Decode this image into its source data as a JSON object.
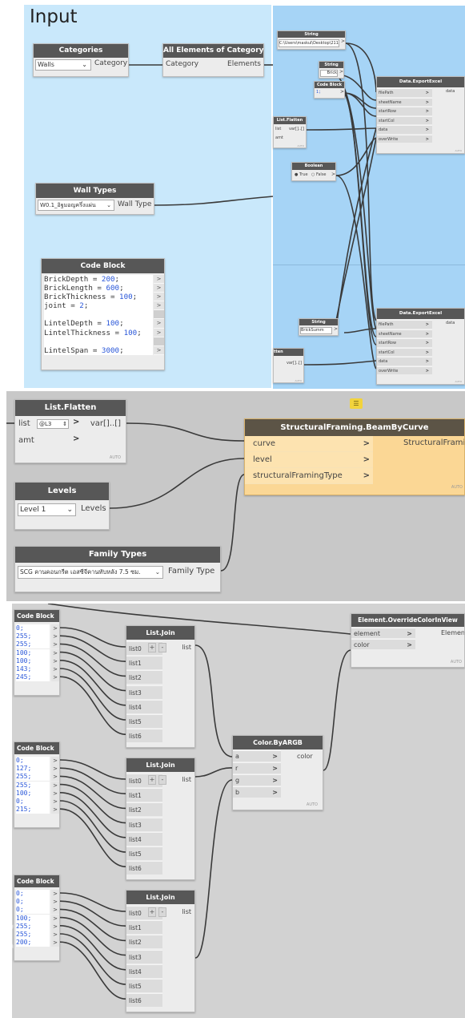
{
  "panel1": {
    "group_title": "Input",
    "categories": {
      "title": "Categories",
      "value": "Walls",
      "output": "Category"
    },
    "all_elements": {
      "title": "All Elements of Category",
      "input": "Category",
      "output": "Elements"
    },
    "wall_types": {
      "title": "Wall Types",
      "value": "W0.1_อิฐมอญครึ่งแผ่น",
      "output": "Wall Type"
    },
    "code_block": {
      "title": "Code Block",
      "lines": [
        "BrickDepth = 200;",
        "BrickLength = 600;",
        "BrickThickness = 100;",
        "joint = 2;",
        "",
        "LintelDepth = 100;",
        "LintelThickness = 100;",
        "",
        "LintelSpan = 3000;"
      ]
    },
    "string_path": {
      "title": "String",
      "value": "C:\\Users\\maskul\\Desktop\\2111"
    },
    "string_brick": {
      "title": "String",
      "value": "Brick"
    },
    "code_block_small": {
      "title": "Code Block",
      "value": "1;"
    },
    "list_flatten": {
      "title": "List.Flatten",
      "in1": "list",
      "in2": "amt",
      "out": "var[]..[]",
      "auto": "AUTO"
    },
    "boolean": {
      "title": "Boolean",
      "true_label": "True",
      "false_label": "False"
    },
    "export1": {
      "title": "Data.ExportExcel",
      "inputs": [
        "filePath",
        "sheetName",
        "startRow",
        "startCol",
        "data",
        "overWrite"
      ],
      "output": "data",
      "auto": "AUTO"
    },
    "string_summ": {
      "title": "String",
      "value": "BrickSumm"
    },
    "flatten_partial": {
      "title": "tten",
      "out": "var[]..[]",
      "auto": "AUTO"
    },
    "export2": {
      "title": "Data.ExportExcel",
      "inputs": [
        "filePath",
        "sheetName",
        "startRow",
        "startCol",
        "data",
        "overWrite"
      ],
      "output": "data",
      "auto": "AUTO"
    }
  },
  "panel2": {
    "list_flatten": {
      "title": "List.Flatten",
      "in1": "list",
      "in2": "amt",
      "field": "@L3",
      "out": "var[]..[]",
      "auto": "AUTO"
    },
    "beam": {
      "title": "StructuralFraming.BeamByCurve",
      "inputs": [
        "curve",
        "level",
        "structuralFramingType"
      ],
      "output": "StructuralFraming",
      "auto": "AUTO"
    },
    "levels": {
      "title": "Levels",
      "value": "Level 1",
      "output": "Levels"
    },
    "family_types": {
      "title": "Family Types",
      "value": "SCG คานคอนกรีต เอสซีจีคานทับหลัง 7.5 ซม.",
      "output": "Family Type"
    }
  },
  "panel3": {
    "code_blocks": [
      {
        "title": "Code Block",
        "lines": [
          "0;",
          "255;",
          "255;",
          "100;",
          "100;",
          "143;",
          "245;"
        ]
      },
      {
        "title": "Code Block",
        "lines": [
          "0;",
          "127;",
          "255;",
          "255;",
          "100;",
          "0;",
          "215;"
        ]
      },
      {
        "title": "Code Block",
        "lines": [
          "0;",
          "0;",
          "0;",
          "100;",
          "255;",
          "255;",
          "200;"
        ]
      }
    ],
    "list_join": {
      "title": "List.Join",
      "inputs": [
        "list0",
        "list1",
        "list2",
        "list3",
        "list4",
        "list5",
        "list6"
      ],
      "plus": "+",
      "minus": "-",
      "output": "list"
    },
    "color_argb": {
      "title": "Color.ByARGB",
      "inputs": [
        "a",
        "r",
        "g",
        "b"
      ],
      "output": "color",
      "auto": "AUTO"
    },
    "override": {
      "title": "Element.OverrideColorInView",
      "inputs": [
        "element",
        "color"
      ],
      "output": "Element",
      "auto": "AUTO"
    }
  }
}
